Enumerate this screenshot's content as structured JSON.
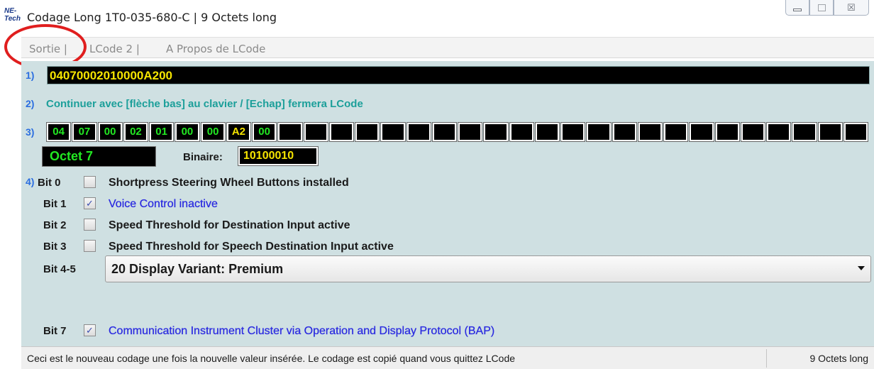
{
  "window": {
    "icon_text": [
      "NE-",
      "Tech"
    ],
    "title": "Codage Long  1T0-035-680-C | 9 Octets long",
    "controls": [
      "minimize-icon",
      "maximize-icon",
      "close-icon"
    ],
    "close_glyph": "☒"
  },
  "menu": {
    "items": [
      "Sortie |",
      "LCode 2 |",
      "A Propos de LCode"
    ]
  },
  "coding": {
    "step1": "1)",
    "hex_value": "04070002010000A200",
    "step2": "2)",
    "instruction": "Continuer avec [flèche bas] au clavier / [Echap] fermera LCode",
    "step3": "3)",
    "bytes": [
      "04",
      "07",
      "00",
      "02",
      "01",
      "00",
      "00",
      "A2",
      "00",
      "",
      "",
      "",
      "",
      "",
      "",
      "",
      "",
      "",
      "",
      "",
      "",
      "",
      "",
      "",
      "",
      "",
      "",
      "",
      "",
      "",
      "",
      ""
    ],
    "selected_byte_index": 7,
    "octet_label": "Octet 7",
    "binary_label": "Binaire:",
    "binary_value": "10100010"
  },
  "bits": {
    "step4": "4)",
    "rows": [
      {
        "label": "Bit 0",
        "checked": false,
        "desc": "Shortpress Steering Wheel Buttons installed"
      },
      {
        "label": "Bit 1",
        "checked": true,
        "desc": "Voice Control inactive"
      },
      {
        "label": "Bit 2",
        "checked": false,
        "desc": "Speed Threshold for Destination Input active"
      },
      {
        "label": "Bit 3",
        "checked": false,
        "desc": "Speed Threshold for Speech Destination Input active"
      }
    ],
    "range_label": "Bit 4-5",
    "range_value": "20 Display Variant: Premium",
    "bit7": {
      "label": "Bit 7",
      "checked": true,
      "desc": "Communication Instrument Cluster via Operation and Display Protocol (BAP)"
    }
  },
  "status": {
    "message": "Ceci est le nouveau codage une fois la nouvelle valeur insérée.  Le codage est copié quand vous quittez LCode",
    "length": "9 Octets long"
  },
  "colors": {
    "panel_bg": "#cfe0e2",
    "byte_text": "#22e822",
    "selected_text": "#f5e400",
    "instruction_text": "#1c9f9a",
    "checked_desc": "#2a2ae0",
    "annotation_circle": "#e01e1e"
  }
}
